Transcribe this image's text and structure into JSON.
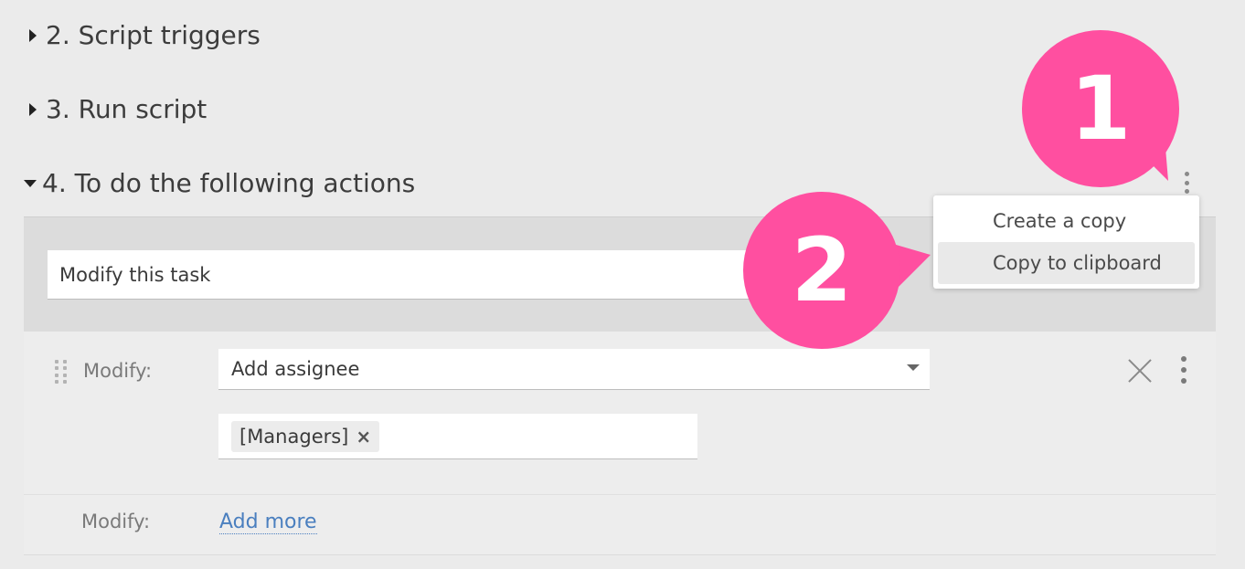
{
  "sections": {
    "script_triggers": "2. Script triggers",
    "run_script": "3. Run script",
    "actions": "4. To do the following actions"
  },
  "action": {
    "name_value": "Modify this task",
    "modify_label": "Modify:",
    "select_value": "Add assignee",
    "tag": "[Managers]",
    "tag_remove": "×",
    "add_more_label": "Modify:",
    "add_more": "Add more"
  },
  "context_menu": {
    "items": [
      "Create a copy",
      "Copy to clipboard"
    ]
  },
  "callouts": {
    "first": "1",
    "second": "2"
  },
  "colors": {
    "callout": "#ff4fa0",
    "link": "#4a7fbf",
    "background": "#ebebeb"
  }
}
